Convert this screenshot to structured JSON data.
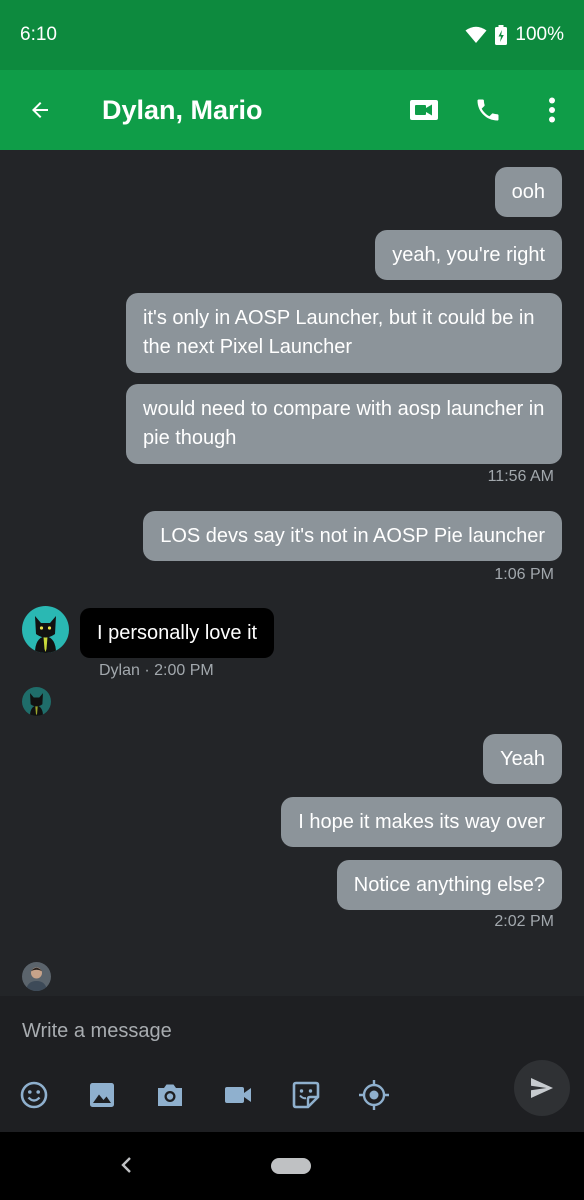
{
  "status_bar": {
    "time": "6:10",
    "battery": "100%"
  },
  "header": {
    "title": "Dylan, Mario",
    "icons": [
      "back-arrow-icon",
      "video-call-icon",
      "phone-icon",
      "more-vert-icon"
    ]
  },
  "messages": [
    {
      "text": "ooh"
    },
    {
      "text": "yeah, you're right"
    },
    {
      "text": "it's only in AOSP Launcher, but it could be in the next Pixel Launcher"
    },
    {
      "text": "would need to compare with aosp launcher in pie though"
    },
    {
      "text": "LOS devs say it's not in AOSP Pie launcher"
    },
    {
      "text": "I personally love it"
    },
    {
      "text": "Yeah"
    },
    {
      "text": "I hope it makes its way over"
    },
    {
      "text": "Notice anything else?"
    }
  ],
  "timestamps": {
    "t1": "11:56 AM",
    "t2": "1:06 PM",
    "t3": "Dylan · 2:00 PM",
    "t4": "2:02 PM"
  },
  "composer": {
    "placeholder": "Write a message",
    "tools": [
      "emoji-icon",
      "image-icon",
      "camera-icon",
      "video-icon",
      "sticker-icon",
      "location-icon"
    ]
  },
  "colors": {
    "status_bar": "#0d8a3e",
    "app_bar": "#0f9d48",
    "background": "#232528",
    "outgoing_bubble": "#8c949a",
    "incoming_bubble": "#000000"
  }
}
